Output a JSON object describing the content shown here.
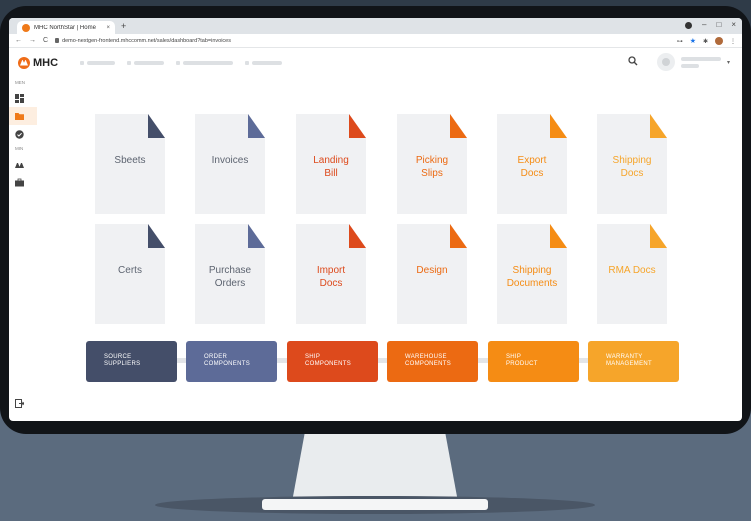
{
  "browser": {
    "tab_title": "MHC NorthStar | Home",
    "tab_close": "×",
    "new_tab": "+",
    "url": "demo-nextgen-frontend.mhccomm.net/sales/dashboard?tab=invoices",
    "nav_back": "←",
    "nav_forward": "→",
    "nav_reload": "C",
    "minimize": "–",
    "maximize": "□",
    "close": "×",
    "menu": "⋮",
    "star": "★",
    "key": "⊶",
    "extensions": "✱"
  },
  "app": {
    "logo_text": "MHC",
    "user_chevron": "▾"
  },
  "sidebar": {
    "section1_label": "MEN",
    "section2_label": "MIN"
  },
  "colors": {
    "navy": "#444e69",
    "slate": "#5d6b98",
    "red_orange": "#dd4a1c",
    "orange": "#ec6a12",
    "bright_orange": "#f58c14",
    "amber": "#f6a52a"
  },
  "documents": [
    {
      "label": "Sbeets",
      "color": "#444e69",
      "text_color": "#5d6470"
    },
    {
      "label": "Invoices",
      "color": "#5d6b98",
      "text_color": "#5d6470"
    },
    {
      "label": "Landing\nBill",
      "color": "#dd4a1c",
      "text_color": "#dd4a1c"
    },
    {
      "label": "Picking\nSlips",
      "color": "#ec6a12",
      "text_color": "#ec6a12"
    },
    {
      "label": "Export\nDocs",
      "color": "#f58c14",
      "text_color": "#f58c14"
    },
    {
      "label": "Shipping\nDocs",
      "color": "#f6a52a",
      "text_color": "#f6a52a"
    },
    {
      "label": "Certs",
      "color": "#444e69",
      "text_color": "#5d6470"
    },
    {
      "label": "Purchase\nOrders",
      "color": "#5d6b98",
      "text_color": "#5d6470"
    },
    {
      "label": "Import\nDocs",
      "color": "#dd4a1c",
      "text_color": "#dd4a1c"
    },
    {
      "label": "Design",
      "color": "#ec6a12",
      "text_color": "#ec6a12"
    },
    {
      "label": "Shipping\nDocuments",
      "color": "#f58c14",
      "text_color": "#f58c14"
    },
    {
      "label": "RMA Docs",
      "color": "#f6a52a",
      "text_color": "#f6a52a"
    }
  ],
  "stages": [
    {
      "label": "SOURCE\nSUPPLIERS",
      "color": "#444e69"
    },
    {
      "label": "ORDER\nCOMPONENTS",
      "color": "#5d6b98"
    },
    {
      "label": "SHIP\nCOMPONENTS",
      "color": "#dd4a1c"
    },
    {
      "label": "WAREHOUSE\nCOMPONENTS",
      "color": "#ec6a12"
    },
    {
      "label": "SHIP\nPRODUCT",
      "color": "#f58c14"
    },
    {
      "label": "WARRANTY\nMANAGEMENT",
      "color": "#f6a52a"
    }
  ]
}
